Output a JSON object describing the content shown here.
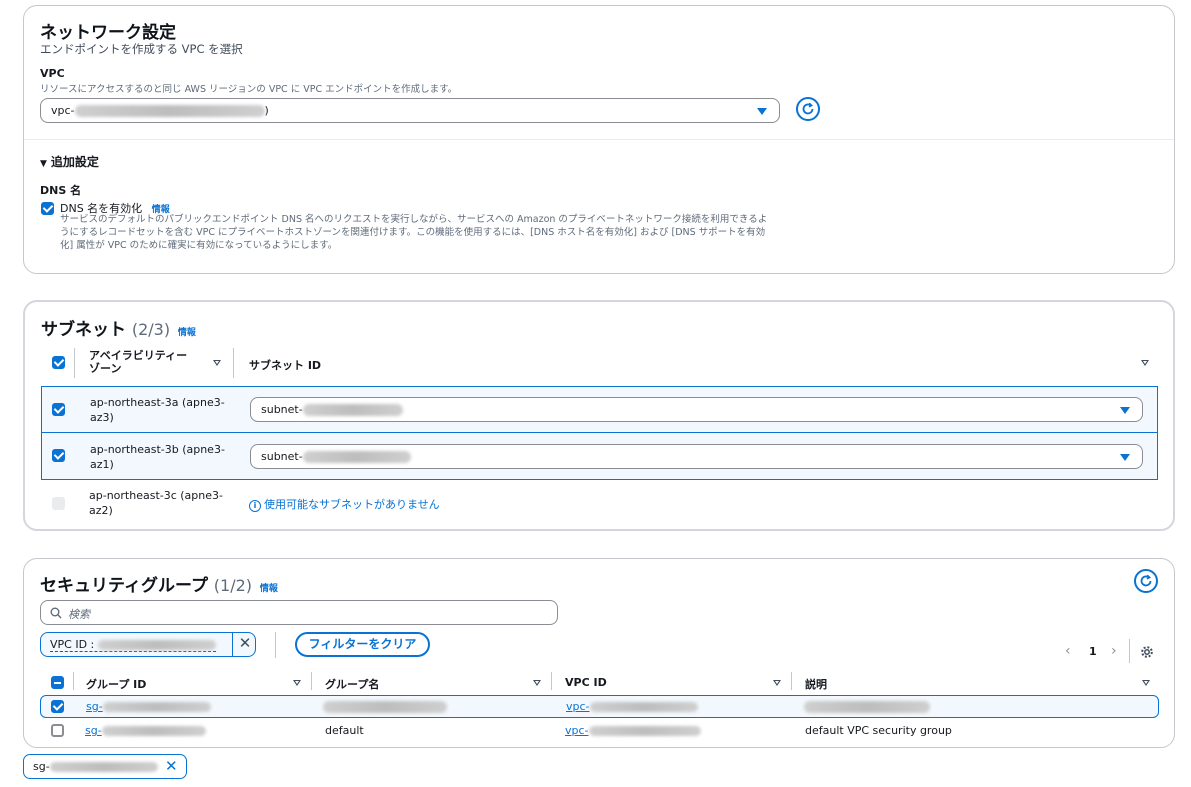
{
  "network": {
    "title": "ネットワーク設定",
    "subtitle": "エンドポイントを作成する VPC を選択",
    "vpc_label": "VPC",
    "vpc_desc": "リソースにアクセスするのと同じ AWS リージョンの VPC に VPC エンドポイントを作成します。",
    "vpc_prefix": "vpc-",
    "vpc_suffix": ")",
    "additional": "追加設定",
    "dns_heading": "DNS 名",
    "dns_checkbox": "DNS 名を有効化",
    "info": "情報",
    "dns_desc": [
      "サービスのデフォルトのパブリックエンドポイント DNS 名へのリクエストを実行しながら、サービスへの Amazon のプライベートネットワーク接続を利用できるよ",
      "うにするレコードセットを含む VPC にプライベートホストゾーンを関連付けます。この機能を使用するには、[DNS ホスト名を有効化] および [DNS サポートを有効",
      "化] 属性が VPC のために確実に有効になっているようにします。"
    ]
  },
  "subnets": {
    "title": "サブネット",
    "count": "(2/3)",
    "info": "情報",
    "col_az": [
      "アベイラビリティー",
      "ゾーン"
    ],
    "col_subnet": "サブネット ID",
    "rows": [
      {
        "az": [
          "ap-northeast-3a (apne3-",
          "az3)"
        ],
        "subnet": "subnet-",
        "checked": true
      },
      {
        "az": [
          "ap-northeast-3b (apne3-",
          "az1)"
        ],
        "subnet": "subnet-",
        "checked": true
      },
      {
        "az": [
          "ap-northeast-3c (apne3-",
          "az2)"
        ],
        "note": "使用可能なサブネットがありません",
        "checked": false
      }
    ]
  },
  "sg": {
    "title": "セキュリティグループ",
    "count": "(1/2)",
    "info": "情報",
    "search_placeholder": "検索",
    "filter_token": "VPC ID :",
    "clear_filters": "フィルターをクリア",
    "page": "1",
    "columns": [
      "グループ ID",
      "グループ名",
      "VPC ID",
      "説明"
    ],
    "rows": [
      {
        "id": "sg-",
        "name": "",
        "vpc": "vpc-",
        "desc": "",
        "checked": true
      },
      {
        "id": "sg-",
        "name": "default",
        "vpc": "vpc-",
        "desc": "default VPC security group",
        "checked": false
      }
    ],
    "selected_token": "sg-"
  },
  "colors": {
    "accent": "#0972d3",
    "border": "#c6c6cd",
    "text": "#16191f"
  }
}
